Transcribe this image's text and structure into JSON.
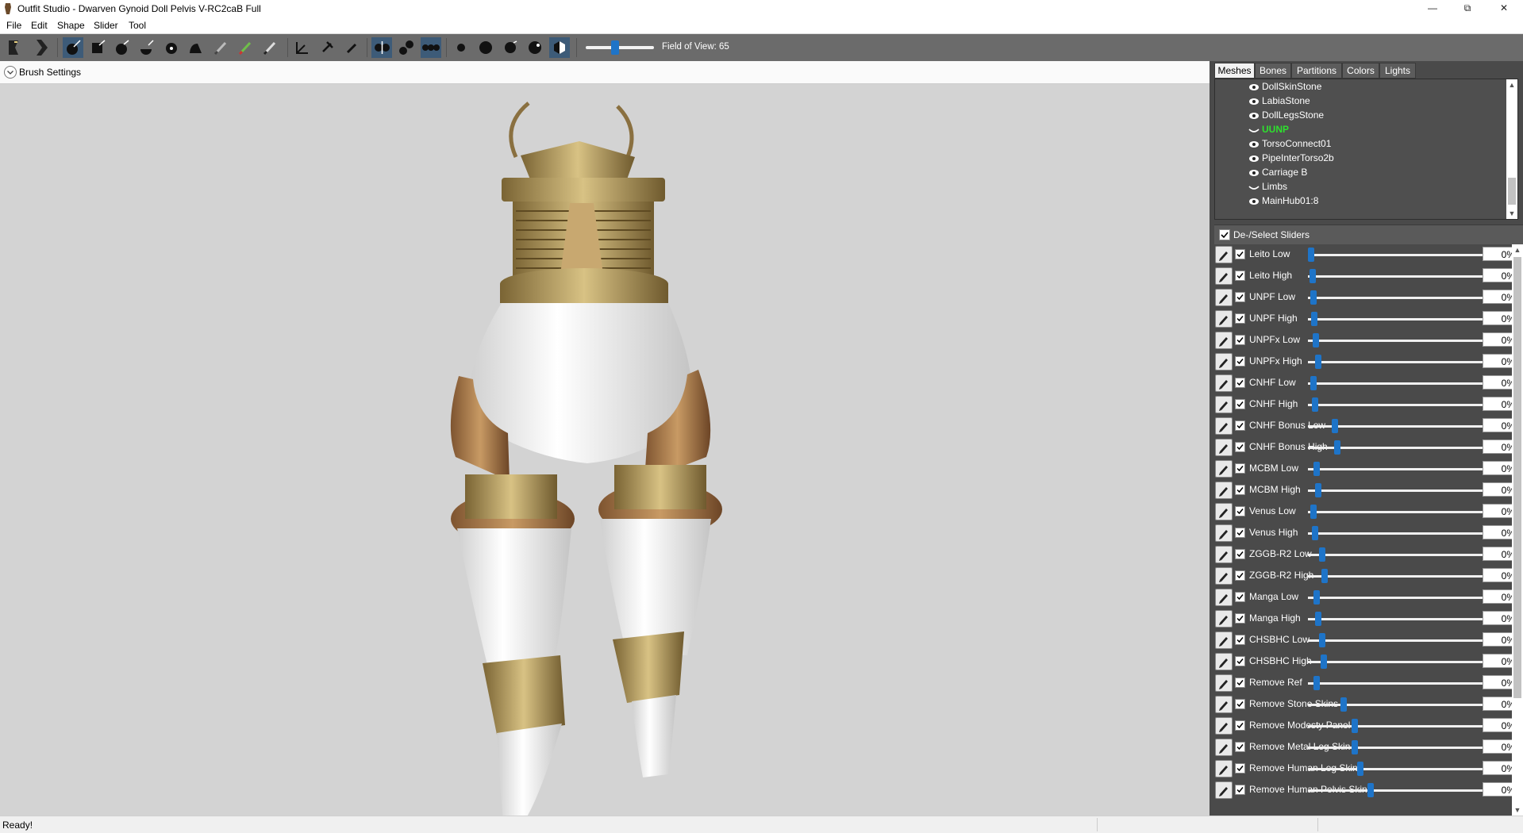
{
  "window": {
    "title": "Outfit Studio - Dwarven Gynoid Doll Pelvis V-RC2caB Full",
    "minimize_glyph": "—",
    "restore_glyph": "⧉",
    "close_glyph": "✕"
  },
  "menu": {
    "items": [
      "File",
      "Edit",
      "Shape",
      "Slider",
      "Tool"
    ]
  },
  "toolbar": {
    "fov_label": "Field of View: 65",
    "fov_value": 65
  },
  "brush_settings": {
    "label": "Brush Settings"
  },
  "panel": {
    "tabs": [
      "Meshes",
      "Bones",
      "Partitions",
      "Colors",
      "Lights"
    ],
    "active_tab": "Meshes",
    "meshes": [
      {
        "name": "DollSkinStone",
        "visible": true
      },
      {
        "name": "LabiaStone",
        "visible": true
      },
      {
        "name": "DollLegsStone",
        "visible": true
      },
      {
        "name": "UUNP",
        "visible": false,
        "selected": true
      },
      {
        "name": "TorsoConnect01",
        "visible": true
      },
      {
        "name": "PipeInterTorso2b",
        "visible": true
      },
      {
        "name": "Carriage B",
        "visible": true
      },
      {
        "name": "Limbs",
        "visible": false
      },
      {
        "name": "MainHub01:8",
        "visible": true
      }
    ],
    "deselect_label": "De-/Select Sliders",
    "sliders": [
      {
        "name": "Leito Low",
        "value": "0%"
      },
      {
        "name": "Leito High",
        "value": "0%"
      },
      {
        "name": "UNPF Low",
        "value": "0%"
      },
      {
        "name": "UNPF High",
        "value": "0%"
      },
      {
        "name": "UNPFx Low",
        "value": "0%"
      },
      {
        "name": "UNPFx High",
        "value": "0%"
      },
      {
        "name": "CNHF Low",
        "value": "0%"
      },
      {
        "name": "CNHF High",
        "value": "0%"
      },
      {
        "name": "CNHF Bonus Low",
        "value": "0%"
      },
      {
        "name": "CNHF Bonus High",
        "value": "0%"
      },
      {
        "name": "MCBM Low",
        "value": "0%"
      },
      {
        "name": "MCBM High",
        "value": "0%"
      },
      {
        "name": "Venus Low",
        "value": "0%"
      },
      {
        "name": "Venus High",
        "value": "0%"
      },
      {
        "name": "ZGGB-R2 Low",
        "value": "0%"
      },
      {
        "name": "ZGGB-R2 High",
        "value": "0%"
      },
      {
        "name": "Manga Low",
        "value": "0%"
      },
      {
        "name": "Manga High",
        "value": "0%"
      },
      {
        "name": "CHSBHC Low",
        "value": "0%"
      },
      {
        "name": "CHSBHC High",
        "value": "0%"
      },
      {
        "name": "Remove Ref",
        "value": "0%"
      },
      {
        "name": "Remove Stone Skins",
        "value": "0%"
      },
      {
        "name": "Remove Modesty Panel",
        "value": "0%"
      },
      {
        "name": "Remove Metal Leg Skin",
        "value": "0%"
      },
      {
        "name": "Remove Human Leg Skin",
        "value": "0%"
      },
      {
        "name": "Remove Human Pelvis Skins",
        "value": "0%"
      }
    ]
  },
  "status": {
    "text": "Ready!"
  },
  "colors": {
    "toolbar_bg": "#6b6b6b",
    "panel_bg": "#4a4a4a",
    "viewport_bg": "#d3d3d3",
    "accent": "#1e74c8",
    "selected_mesh": "#2ee02e"
  }
}
